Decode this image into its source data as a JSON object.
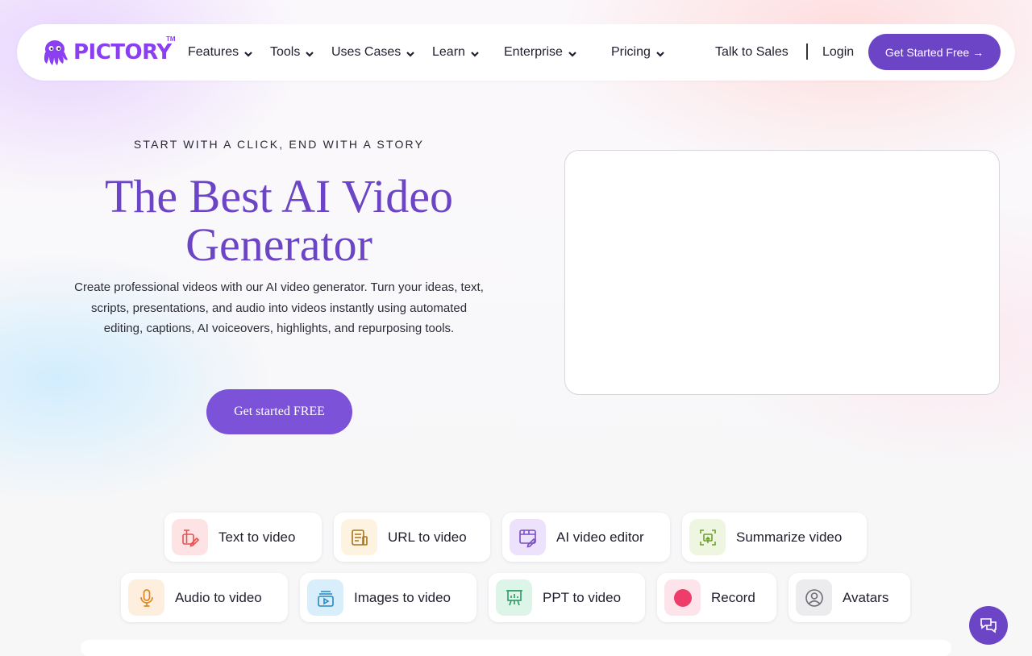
{
  "nav": {
    "logo_text": "PICTORY",
    "trademark": "TM",
    "items": [
      {
        "label": "Features"
      },
      {
        "label": "Tools"
      },
      {
        "label": "Uses Cases"
      },
      {
        "label": "Learn"
      },
      {
        "label": "Enterprise"
      },
      {
        "label": "Pricing"
      }
    ],
    "talk_to_sales": "Talk to Sales",
    "login": "Login",
    "get_started": "Get Started Free →"
  },
  "hero": {
    "eyebrow": "START WITH A CLICK, END WITH A STORY",
    "title": "The Best AI Video Generator",
    "description": "Create professional videos with our AI video generator. Turn your ideas, text, scripts, presentations, and audio into videos instantly using automated editing, captions, AI voiceovers, highlights, and repurposing tools.",
    "cta": "Get started FREE"
  },
  "tools": [
    {
      "label": "Text to video",
      "icon": "text-to-video-icon",
      "color": "#e8504f",
      "bg": "#fde3e3"
    },
    {
      "label": "URL to video",
      "icon": "url-to-video-icon",
      "color": "#a8741a",
      "bg": "#fdf3e0"
    },
    {
      "label": "AI video editor",
      "icon": "ai-editor-icon",
      "color": "#7a4cc6",
      "bg": "#ece2fb"
    },
    {
      "label": "Summarize video",
      "icon": "summarize-icon",
      "color": "#6e9e2c",
      "bg": "#eef6e1"
    },
    {
      "label": "Audio to video",
      "icon": "microphone-icon",
      "color": "#e0871e",
      "bg": "#fdeedd"
    },
    {
      "label": "Images to video",
      "icon": "images-icon",
      "color": "#2488c4",
      "bg": "#d8eefb"
    },
    {
      "label": "PPT to video",
      "icon": "presentation-icon",
      "color": "#2c9a64",
      "bg": "#ddf4e8"
    },
    {
      "label": "Record",
      "icon": "record-icon",
      "color": "#ee3d6a",
      "bg": "#fde4ea"
    },
    {
      "label": "Avatars",
      "icon": "avatar-icon",
      "color": "#6d6d73",
      "bg": "#ececee"
    }
  ],
  "colors": {
    "brand": "#6b45c6",
    "logo": "#8a3ff0"
  }
}
